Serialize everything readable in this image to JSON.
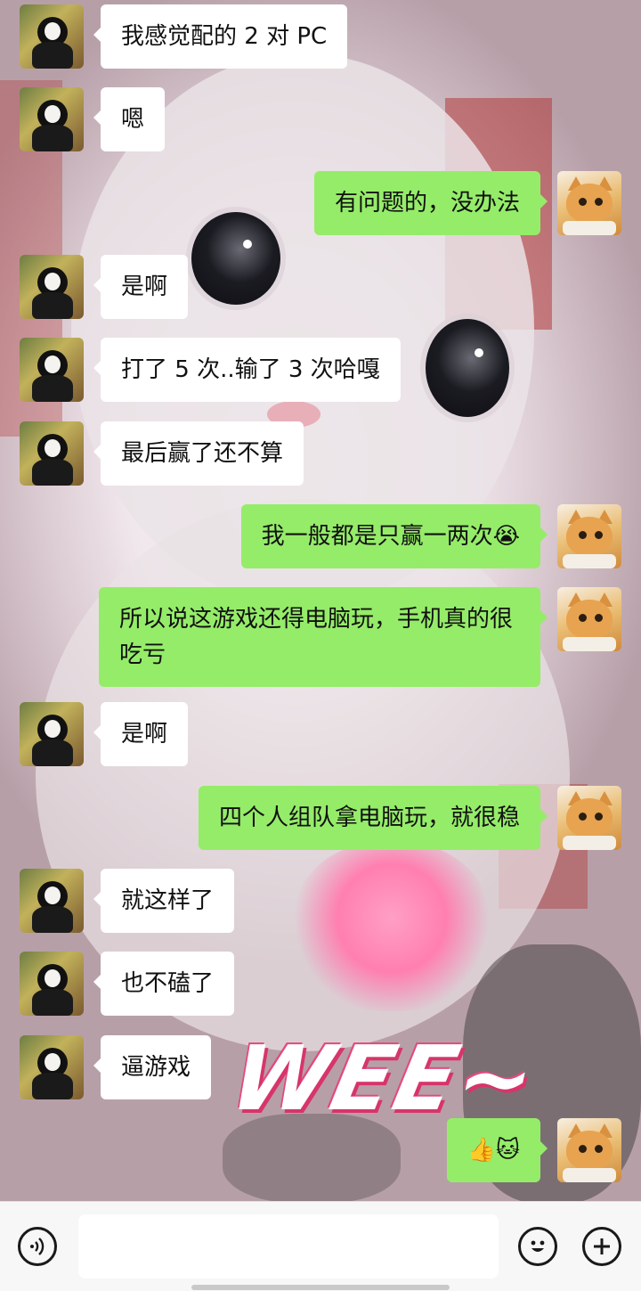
{
  "colors": {
    "my_bubble": "#95ec69",
    "friend_bubble": "#ffffff",
    "input_bar": "#f7f7f7"
  },
  "background": {
    "overlay_text": "WEE~"
  },
  "messages": [
    {
      "sender": "friend",
      "text": "我感觉配的 2 对 PC"
    },
    {
      "sender": "friend",
      "text": "嗯"
    },
    {
      "sender": "me",
      "text": "有问题的，没办法"
    },
    {
      "sender": "friend",
      "text": "是啊"
    },
    {
      "sender": "friend",
      "text": "打了 5 次..输了 3 次哈嘎"
    },
    {
      "sender": "friend",
      "text": "最后赢了还不算"
    },
    {
      "sender": "me",
      "text": "我一般都是只赢一两次😭"
    },
    {
      "sender": "me",
      "text": "所以说这游戏还得电脑玩，手机真的很吃亏"
    },
    {
      "sender": "friend",
      "text": "是啊"
    },
    {
      "sender": "me",
      "text": "四个人组队拿电脑玩，就很稳"
    },
    {
      "sender": "friend",
      "text": "就这样了"
    },
    {
      "sender": "friend",
      "text": "也不磕了"
    },
    {
      "sender": "friend",
      "text": "逼游戏"
    },
    {
      "sender": "me",
      "text": "👍🐱"
    }
  ],
  "input_bar": {
    "voice_icon": "voice-icon",
    "emoji_icon": "emoji-icon",
    "plus_icon": "plus-icon",
    "text_value": ""
  }
}
